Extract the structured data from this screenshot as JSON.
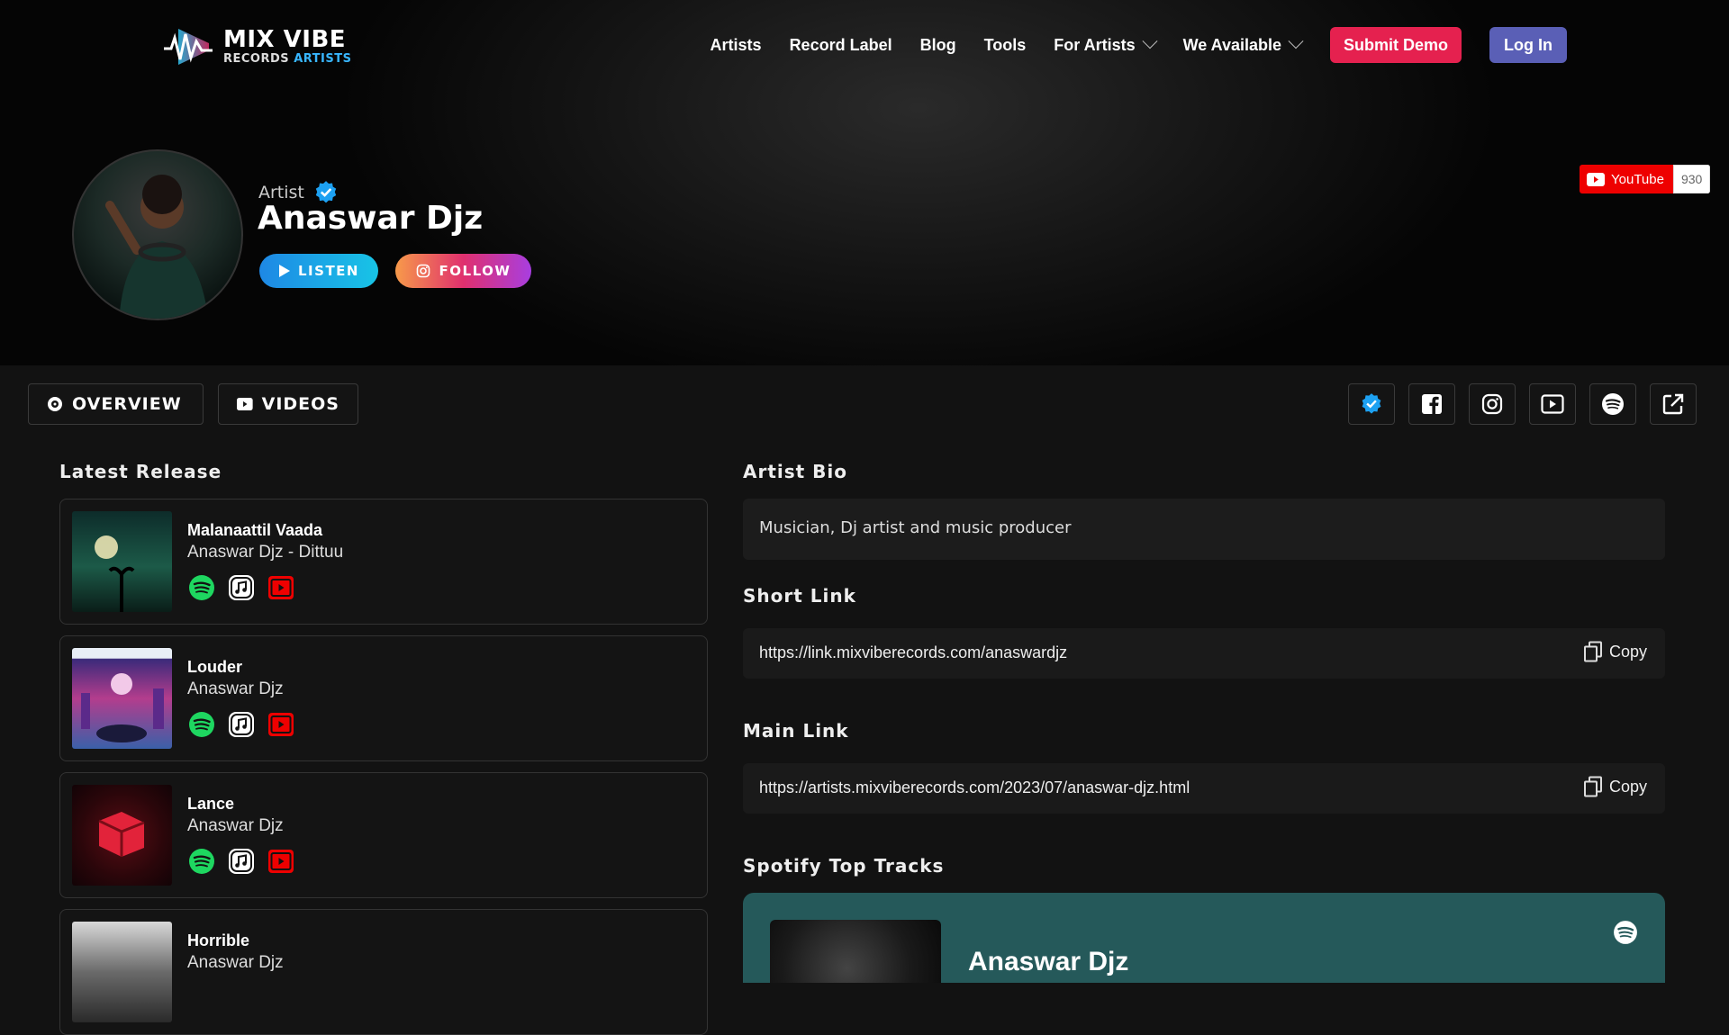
{
  "brand": {
    "title": "MIX VIBE",
    "sub_main": "RECORDS",
    "sub_accent": "ARTISTS"
  },
  "nav": {
    "items": [
      "Artists",
      "Record Label",
      "Blog",
      "Tools"
    ],
    "dropdowns": [
      "For Artists",
      "We Available"
    ],
    "submit": "Submit Demo",
    "login": "Log In"
  },
  "artist": {
    "label": "Artist",
    "name": "Anaswar Djz",
    "listen": "LISTEN",
    "follow": "FOLLOW"
  },
  "youtube": {
    "label": "YouTube",
    "count": "930"
  },
  "tabs": [
    "OVERVIEW",
    "VIDEOS"
  ],
  "social_icons": [
    "verified-icon",
    "facebook-icon",
    "instagram-icon",
    "youtube-icon",
    "spotify-icon",
    "external-link-icon"
  ],
  "latest_release": {
    "heading": "Latest Release",
    "items": [
      {
        "title": "Malanaattil Vaada",
        "artist": "Anaswar Djz - Dittuu"
      },
      {
        "title": "Louder",
        "artist": "Anaswar Djz"
      },
      {
        "title": "Lance",
        "artist": "Anaswar Djz"
      },
      {
        "title": "Horrible",
        "artist": "Anaswar Djz"
      }
    ]
  },
  "bio": {
    "heading": "Artist Bio",
    "text": "Musician, Dj artist and music producer"
  },
  "short_link": {
    "heading": "Short Link",
    "url": "https://link.mixviberecords.com/anaswardjz",
    "copy": "Copy"
  },
  "main_link": {
    "heading": "Main Link",
    "url": "https://artists.mixviberecords.com/2023/07/anaswar-djz.html",
    "copy": "Copy"
  },
  "spotify": {
    "heading": "Spotify Top Tracks",
    "artist": "Anaswar Djz"
  },
  "colors": {
    "submit": "#e5214f",
    "login": "#5a5fb6",
    "spotify_card": "#25595a",
    "verified": "#1da1f2"
  }
}
